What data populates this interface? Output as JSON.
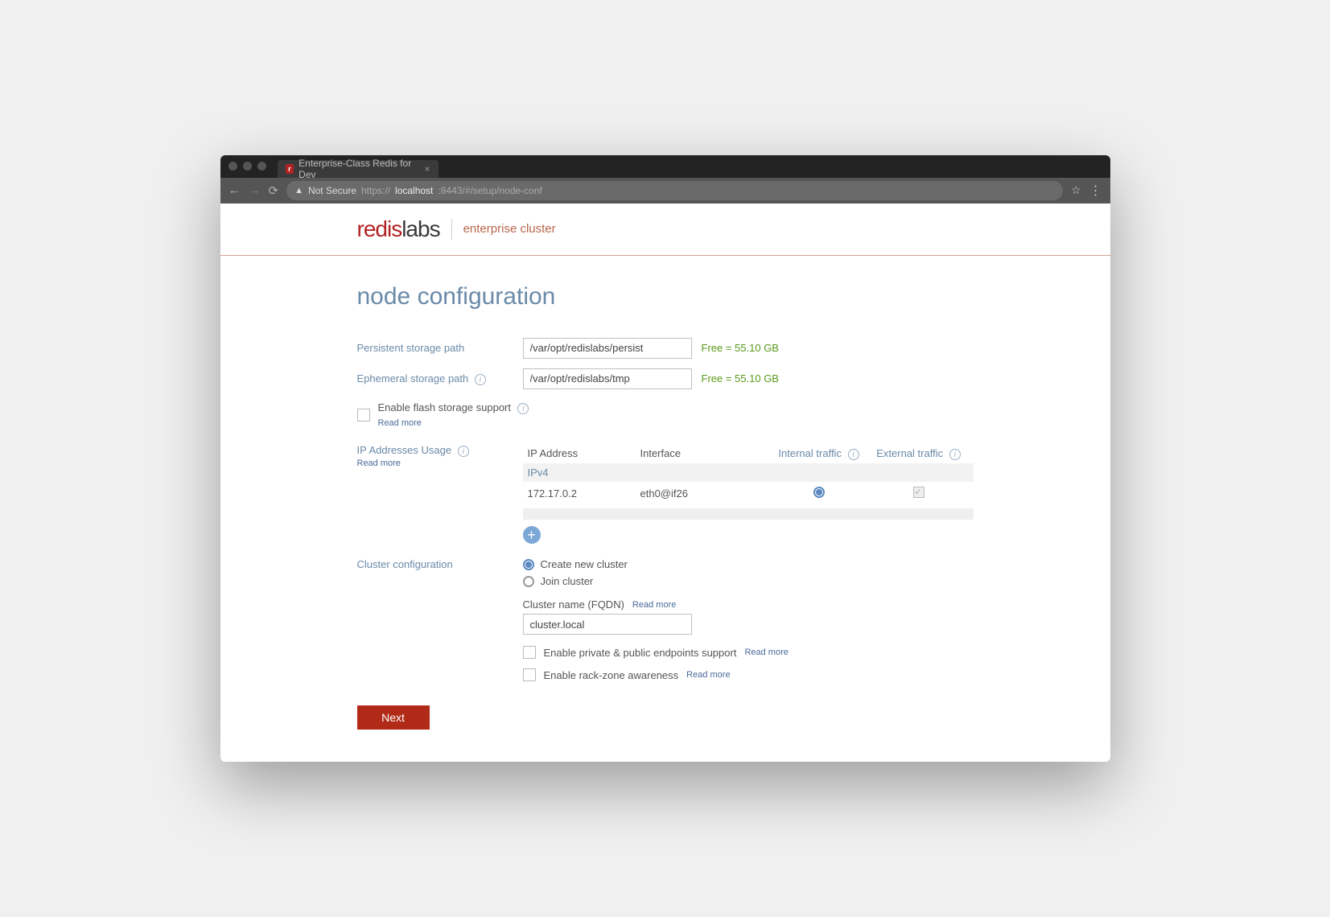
{
  "browser": {
    "tab_title": "Enterprise-Class Redis for Dev",
    "not_secure": "Not Secure",
    "url_protocol": "https://",
    "url_host": "localhost",
    "url_path": ":8443/#/setup/node-conf"
  },
  "brand": {
    "logo_primary": "redis",
    "logo_secondary": "labs",
    "logo_sub": "enterprise cluster"
  },
  "page": {
    "title": "node configuration"
  },
  "storage": {
    "persistent_label": "Persistent storage path",
    "persistent_value": "/var/opt/redislabs/persist",
    "persistent_free": "Free = 55.10 GB",
    "ephemeral_label": "Ephemeral storage path",
    "ephemeral_value": "/var/opt/redislabs/tmp",
    "ephemeral_free": "Free = 55.10 GB",
    "flash_label": "Enable flash storage support",
    "readmore": "Read more"
  },
  "ip": {
    "section_label": "IP Addresses Usage",
    "readmore": "Read more",
    "col_ip": "IP Address",
    "col_interface": "Interface",
    "col_internal": "Internal traffic",
    "col_external": "External traffic",
    "group_ipv4": "IPv4",
    "rows": [
      {
        "address": "172.17.0.2",
        "interface": "eth0@if26"
      }
    ]
  },
  "cluster": {
    "section_label": "Cluster configuration",
    "option_create": "Create new cluster",
    "option_join": "Join cluster",
    "fqdn_label": "Cluster name (FQDN)",
    "fqdn_value": "cluster.local",
    "readmore": "Read more",
    "endpoints_label": "Enable private & public endpoints support",
    "rackzone_label": "Enable rack-zone awareness"
  },
  "actions": {
    "next": "Next"
  }
}
